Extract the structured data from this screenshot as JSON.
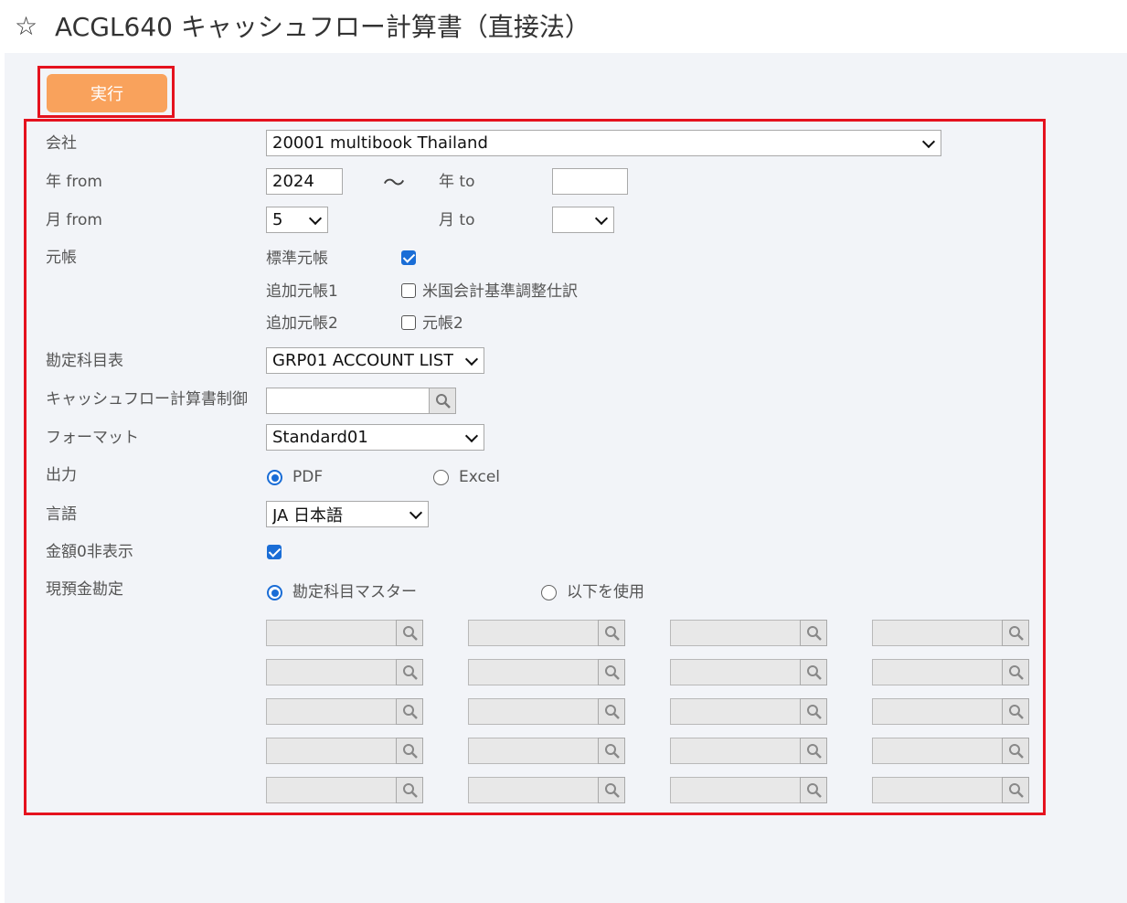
{
  "header": {
    "star_icon": "star-outline",
    "title": "ACGL640 キャッシュフロー計算書（直接法）"
  },
  "toolbar": {
    "run_label": "実行"
  },
  "form": {
    "company": {
      "label": "会社",
      "value": "20001 multibook Thailand"
    },
    "year_from": {
      "label": "年 from",
      "value": "2024"
    },
    "range_sep": "〜",
    "year_to": {
      "label": "年 to",
      "value": ""
    },
    "month_from": {
      "label": "月 from",
      "value": "5"
    },
    "month_to": {
      "label": "月 to",
      "value": ""
    },
    "ledger": {
      "label": "元帳",
      "standard": {
        "label": "標準元帳",
        "checked": true
      },
      "additional1": {
        "label": "追加元帳1",
        "option": "米国会計基準調整仕訳",
        "checked": false
      },
      "additional2": {
        "label": "追加元帳2",
        "option": "元帳2",
        "checked": false
      }
    },
    "account_table": {
      "label": "勘定科目表",
      "value": "GRP01 ACCOUNT LIST"
    },
    "cf_control": {
      "label": "キャッシュフロー計算書制御",
      "value": ""
    },
    "format": {
      "label": "フォーマット",
      "value": "Standard01"
    },
    "output": {
      "label": "出力",
      "options": [
        "PDF",
        "Excel"
      ],
      "selected": "PDF"
    },
    "language": {
      "label": "言語",
      "value": "JA 日本語"
    },
    "hide_zero": {
      "label": "金額0非表示",
      "checked": true
    },
    "cash_accounts": {
      "label": "現預金勘定",
      "options": [
        "勘定科目マスター",
        "以下を使用"
      ],
      "selected": "勘定科目マスター",
      "lookup_rows": 5,
      "lookup_cols": 4
    }
  },
  "colors": {
    "accent": "#1a6dd6",
    "run_button": "#f9a25c",
    "highlight_border": "#e5121e",
    "content_bg": "#f2f4f8"
  }
}
